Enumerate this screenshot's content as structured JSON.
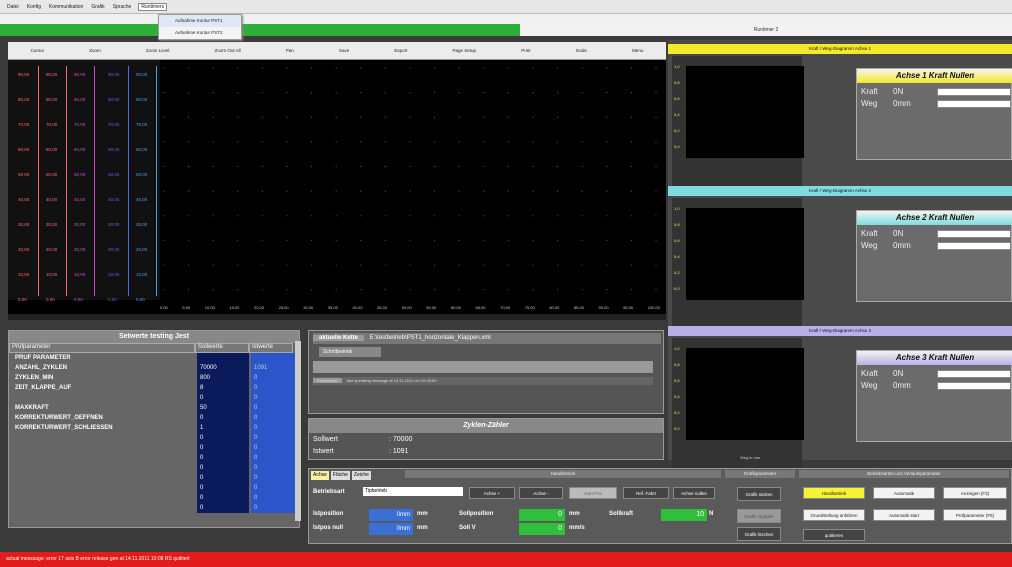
{
  "menu": [
    "Datei",
    "Konfig",
    "Kommunikation",
    "Grafik",
    "Sprache",
    "Runtimers"
  ],
  "dropdown": [
    "Aufnahme Kontur PST1",
    "Aufnahme Kontur PST2"
  ],
  "progress": {
    "label": "Runtimer 2",
    "fraction": 0.52
  },
  "chart_toolbar": [
    "Cursor",
    "Zoom",
    "Zoom Level",
    "Zoom Out All",
    "Pan",
    "Save",
    "Export",
    "Page Setup",
    "Print",
    "Scale",
    "Menu"
  ],
  "chart_data": {
    "type": "line",
    "x": [
      0,
      5,
      10,
      15,
      20,
      25,
      30,
      35,
      40,
      45,
      50,
      55,
      60,
      65,
      70,
      75,
      80,
      85,
      90,
      95,
      100
    ],
    "x_tick_labels": [
      "0,00",
      "5,00",
      "10,00",
      "15,00",
      "20,00",
      "25,00",
      "30,00",
      "35,00",
      "40,00",
      "45,00",
      "50,00",
      "55,00",
      "60,00",
      "65,00",
      "70,00",
      "75,00",
      "80,00",
      "85,00",
      "90,00",
      "95,00",
      "100,00"
    ],
    "y_tick_labels": [
      "90,00",
      "80,00",
      "70,00",
      "60,00",
      "50,00",
      "40,00",
      "30,00",
      "20,00",
      "10,00",
      "0,00"
    ],
    "series": []
  },
  "axis_panels": [
    {
      "header": "Kraft / Weg-Diagramm Achse 1",
      "title": "Achse 1 Kraft Nullen",
      "kraft_label": "Kraft",
      "kraft_val": "0N",
      "weg_label": "Weg",
      "weg_val": "0mm",
      "color": "#f3e82a",
      "ticks": [
        "1,0",
        "0,8",
        "0,6",
        "0,4",
        "0,2",
        "0,0"
      ]
    },
    {
      "header": "Kraft / Weg-Diagramm Achse 2",
      "title": "Achse 2 Kraft Nullen",
      "kraft_label": "Kraft",
      "kraft_val": "0N",
      "weg_label": "Weg",
      "weg_val": "0mm",
      "color": "#7fdbe0",
      "ticks": [
        "1,0",
        "0,8",
        "0,6",
        "0,4",
        "0,2",
        "0,0"
      ]
    },
    {
      "header": "Kraft / Weg-Diagramm Achse 3",
      "title": "Achse 3 Kraft Nullen",
      "kraft_label": "Kraft",
      "kraft_val": "0N",
      "weg_label": "Weg",
      "weg_val": "0mm",
      "color": "#b8b0e8",
      "ticks": [
        "1,0",
        "0,8",
        "0,6",
        "0,4",
        "0,2",
        "0,0"
      ]
    }
  ],
  "mini_xlabel": "Weg in mm",
  "setpanel": {
    "title": "Setwerte testing Jest",
    "col_param": "Prüfparameter",
    "col_soll": "Sollwerte",
    "col_ist": "Istwerte",
    "params": [
      "PRUF PARAMETER",
      "ANZAHL_ZYKLEN",
      "ZYKLEN_MIN",
      "ZEIT_KLAPPE_AUF",
      "",
      "MAXKRAFT",
      "KORREKTURWERT_OEFFNEN",
      "KORREKTURWERT_SCHLIESSEN",
      "",
      "",
      "",
      "",
      "",
      "",
      "",
      ""
    ],
    "soll": [
      "",
      "70000",
      "800",
      "8",
      "0",
      "50",
      "0",
      "1",
      "0",
      "0",
      "0",
      "0",
      "0",
      "0",
      "0",
      "0"
    ],
    "ist": [
      "",
      "1091",
      "0",
      "0",
      "0",
      "0",
      "0",
      "0",
      "0",
      "0",
      "0",
      "0",
      "0",
      "0",
      "0",
      "0"
    ]
  },
  "midpanel": {
    "kette_label": "aktuelle Kette",
    "kette_path": "E:\\testbetrieb\\PST1_horizontale_Klappen.xml",
    "select_btn": "Schrittbetrieb",
    "kommentar_label": "Kommentar",
    "kommentar_text": "last operating message at 14.11.2011 um 10:08:59"
  },
  "zyklen": {
    "title": "Zyklen-Zähler",
    "soll_label": "Sollwert",
    "soll_val": ": 70000",
    "ist_label": "Istwert",
    "ist_val": ": 1091"
  },
  "bottom": {
    "tabs": [
      "Achse",
      "Fläche",
      "Zeiche"
    ],
    "hand_title": "Handbetrieb",
    "betriebsart_label": "Betriebsart",
    "betriebsart_val": "Tipbetrieb",
    "buttons": [
      "Achse +",
      "Achse -",
      "start Pos",
      "Ref. Fahrt",
      "Achse nullen"
    ],
    "istposition_label": "Istposition",
    "istposition_val": "0mm",
    "istpos_null_label": "Istpos null",
    "istpos_null_val": "0mm",
    "unit_mm": "mm",
    "sollposition_label": "Sollposition",
    "sollposition_val": "0",
    "soll_v_label": "Soll V",
    "soll_v_val": "0",
    "unit_mms": "mm/s",
    "sollkraft_label": "Sollkraft",
    "sollkraft_val": "10",
    "unit_n": "N",
    "grafik_title": "Grafikparameter",
    "grafik_btns": [
      "Grafik starten",
      "Grafik stoppen",
      "Grafik löschen"
    ],
    "betrieb_title": "Betriebsarten und Verlaufsparameter",
    "betrieb_btns": [
      "Handbetrieb",
      "Automatik",
      "Anzeigen (F3)",
      "Grundstellung anfahren",
      "Automatik start",
      "Prüfparameter (F5)",
      "quittieren"
    ]
  },
  "status": "actual messsage: error 17 axis B error release gen at 14.11.2011 10:08 RS quittiert",
  "colors": {
    "progress": "#2fae3a",
    "status": "#e21b1b",
    "handbetrieb": "#f6f235",
    "automatik": "#e04040"
  }
}
